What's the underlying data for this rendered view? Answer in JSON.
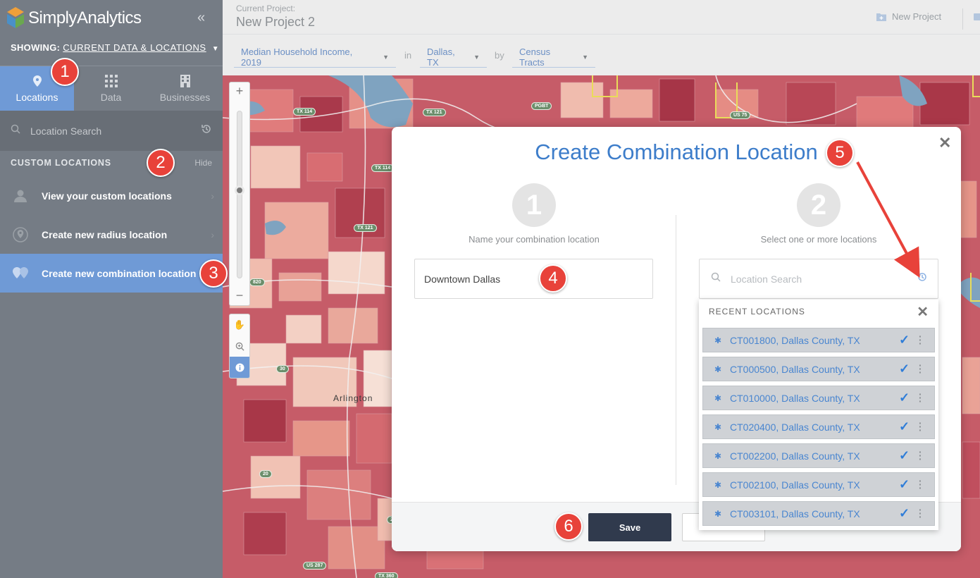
{
  "brand": {
    "name": "SimplyAnalytics",
    "collapse": "«"
  },
  "showing": {
    "label": "SHOWING:",
    "value": "CURRENT DATA & LOCATIONS"
  },
  "side_tabs": [
    {
      "label": "Locations",
      "icon": "map-pin-icon",
      "active": true
    },
    {
      "label": "Data",
      "icon": "grid-icon",
      "active": false
    },
    {
      "label": "Businesses",
      "icon": "building-icon",
      "active": false
    }
  ],
  "side_search": {
    "placeholder": "Location Search"
  },
  "custom_locations": {
    "header": "CUSTOM LOCATIONS",
    "hide": "Hide",
    "items": [
      {
        "label": "View your custom locations",
        "icon": "user-icon"
      },
      {
        "label": "Create new radius location",
        "icon": "radius-pin-icon"
      },
      {
        "label": "Create new combination location",
        "icon": "combination-icon"
      }
    ]
  },
  "topbar": {
    "current_project_label": "Current Project:",
    "project_name": "New Project 2",
    "new_project": "New Project",
    "filters": {
      "variable": "Median Household Income, 2019",
      "in": "in",
      "location": "Dallas, TX",
      "by": "by",
      "geography": "Census Tracts"
    }
  },
  "map": {
    "city_label": "Arlington",
    "shields": [
      "TX 114",
      "TX 121",
      "TX 114",
      "TX 121",
      "PGBT",
      "US 75",
      "820",
      "30",
      "20",
      "20",
      "US 287",
      "TX 360"
    ],
    "zoom_plus": "+",
    "zoom_minus": "−"
  },
  "modal": {
    "title": "Create Combination Location",
    "close": "✕",
    "step1": {
      "number": "1",
      "text": "Name your combination location",
      "value": "Downtown Dallas"
    },
    "step2": {
      "number": "2",
      "text": "Select one or more locations",
      "placeholder": "Location Search"
    },
    "save": "Save",
    "cancel": ""
  },
  "recent": {
    "header": "RECENT LOCATIONS",
    "close": "✕",
    "items": [
      "CT001800, Dallas County, TX",
      "CT000500, Dallas County, TX",
      "CT010000, Dallas County, TX",
      "CT020400, Dallas County, TX",
      "CT002200, Dallas County, TX",
      "CT002100, Dallas County, TX",
      "CT003101, Dallas County, TX"
    ]
  },
  "callouts": [
    "1",
    "2",
    "3",
    "4",
    "5",
    "6"
  ],
  "colors": {
    "accent": "#6f9ad6",
    "title": "#3d7dca",
    "callout": "#e8423a",
    "save": "#303a4d"
  }
}
